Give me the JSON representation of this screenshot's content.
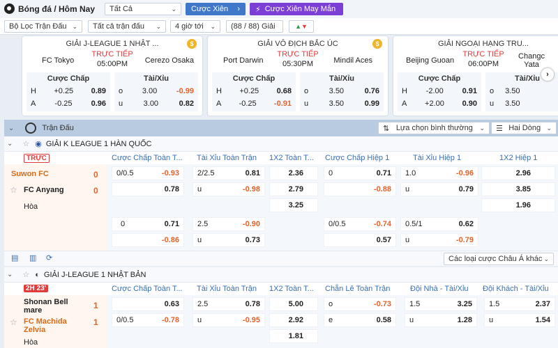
{
  "header": {
    "title": "Bóng đá / Hôm Nay",
    "filter_all": "Tất Cả",
    "parlay": "Cược Xiên",
    "random_parlay": "Cược Xiên May Mắn",
    "match_filter": "Bộ Lọc Trận Đấu",
    "all_matches": "Tất cả trận đấu",
    "hours": "4 giờ tới",
    "league_count": "(88 / 88) Giải"
  },
  "cards": [
    {
      "league": "GIẢI J-LEAGUE 1 NHẬT ...",
      "home": "FC Tokyo",
      "away": "Cerezo Osaka",
      "live": "TRỰC TIẾP",
      "time": "05:00PM",
      "h_label": "Cược Chấp",
      "t_label": "Tài/Xỉu",
      "h1": [
        "H",
        "+0.25",
        "0.89"
      ],
      "h2": [
        "A",
        "-0.25",
        "0.96"
      ],
      "t1": [
        "o",
        "3.00",
        "-0.99"
      ],
      "t2": [
        "u",
        "3.00",
        "0.82"
      ]
    },
    {
      "league": "GIẢI VÔ ĐỊCH BẮC ÚC",
      "home": "Port Darwin",
      "away": "Mindil Aces",
      "live": "TRỰC TIẾP",
      "time": "05:30PM",
      "h_label": "Cược Chấp",
      "t_label": "Tài/Xỉu",
      "h1": [
        "H",
        "+0.25",
        "0.68"
      ],
      "h2": [
        "A",
        "-0.25",
        "-0.91"
      ],
      "t1": [
        "o",
        "3.50",
        "0.76"
      ],
      "t2": [
        "u",
        "3.50",
        "0.99"
      ]
    },
    {
      "league": "GIẢI NGOẠI HẠNG TRU...",
      "home": "Beijing Guoan",
      "away": "Changc Yata",
      "live": "TRỰC TIẾP",
      "time": "06:00PM",
      "h_label": "Cược Chấp",
      "t_label": "Tài/Xỉu",
      "h1": [
        "H",
        "-2.00",
        "0.91"
      ],
      "h2": [
        "A",
        "+2.00",
        "0.90"
      ],
      "t1": [
        "o",
        "3.50",
        ""
      ],
      "t2": [
        "u",
        "3.50",
        ""
      ]
    }
  ],
  "bar": {
    "title": "Trận Đấu",
    "sort": "Lựa chọn bình thường",
    "lines": "Hai Dòng"
  },
  "league1": {
    "name": "GIẢI K LEAGUE 1 HÀN QUỐC",
    "status": "TRỰC",
    "cols": [
      "Cược Chấp Toàn T...",
      "Tài Xỉu Toàn Trận",
      "1X2 Toàn T...",
      "Cược Chấp Hiệp 1",
      "Tài Xỉu Hiệp 1",
      "1X2 Hiệp 1"
    ],
    "home": "Suwon FC",
    "away": "FC Anyang",
    "draw": "Hòa",
    "home_score": "0",
    "away_score": "0",
    "r1": [
      "0/0.5",
      "-0.93",
      "2/2.5",
      "0.81",
      "2.36",
      "0",
      "0.71",
      "1.0",
      "-0.96",
      "2.96"
    ],
    "r2": [
      "0.78",
      "u",
      "-0.98",
      "2.79",
      "-0.88",
      "u",
      "0.79",
      "3.85"
    ],
    "r3": [
      "3.25",
      "1.96"
    ],
    "s1": [
      "0",
      "0.71",
      "2.5",
      "-0.90",
      "0/0.5",
      "-0.74",
      "0.5/1",
      "0.62"
    ],
    "s2": [
      "-0.86",
      "u",
      "0.73",
      "0.57",
      "u",
      "-0.79"
    ],
    "more": "Các loại cược Châu Á khác"
  },
  "league2": {
    "name": "GIẢI J-LEAGUE 1 NHẬT BẢN",
    "status": "2H 23'",
    "cols": [
      "Cược Chấp Toàn T...",
      "Tài Xỉu Toàn Trận",
      "1X2 Toàn T...",
      "Chẵn Lẻ Toàn Trận",
      "Đội Nhà - Tài/Xỉu",
      "Đội Khách - Tài/Xỉu"
    ],
    "home": "Shonan Bell mare",
    "away": "FC Machida Zelvia",
    "draw": "Hòa",
    "home_score": "1",
    "away_score": "1",
    "r1": [
      "0.63",
      "2.5",
      "0.78",
      "5.00",
      "o",
      "-0.73",
      "1.5",
      "3.25",
      "1.5",
      "2.37"
    ],
    "r2": [
      "0/0.5",
      "-0.78",
      "u",
      "-0.95",
      "2.92",
      "e",
      "0.58",
      "u",
      "1.28",
      "u",
      "1.54"
    ],
    "r3": [
      "1.81"
    ]
  }
}
